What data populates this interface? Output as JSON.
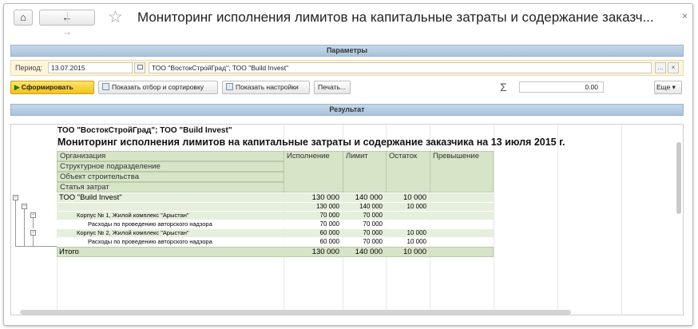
{
  "window": {
    "title": "Мониторинг исполнения лимитов на капитальные затраты и содержание заказч...",
    "close_glyph": "×",
    "home_glyph": "⌂",
    "back_glyph": "←",
    "forward_glyph": "→",
    "star_glyph": "☆"
  },
  "params": {
    "section_label": "Параметры",
    "period_label": "Период:",
    "period_value": "13.07.2015",
    "org_value": "ТОО \"ВостокСтройГрад\"; ТОО \"Build Invest\"",
    "select_glyph": "...",
    "clear_glyph": "×"
  },
  "toolbar": {
    "generate_label": "Сформировать",
    "filter_label": "Показать отбор и сортировку",
    "settings_label": "Показать настройки",
    "print_label": "Печать...",
    "sum_glyph": "Σ",
    "sum_value": "0.00",
    "more_label": "Еще ▾"
  },
  "result": {
    "section_label": "Результат",
    "orgs_line": "ТОО \"ВостокСтройГрад\"; ТОО \"Build Invest\"",
    "report_title": "Мониторинг исполнения лимитов на капитальные затраты и содержание заказчика на 13 июля 2015 г.",
    "header": {
      "organization": "Организация",
      "department": "Структурное подразделение",
      "object": "Объект строительства",
      "article": "Статья затрат",
      "execution": "Исполнение",
      "limit": "Лимит",
      "remainder": "Остаток",
      "excess": "Превышение"
    },
    "rows": [
      {
        "name": "ТОО \"Build Invest\"",
        "execution": "130 000",
        "limit": "140 000",
        "remainder": "10 000"
      },
      {
        "name": "",
        "execution": "130 000",
        "limit": "140 000",
        "remainder": "10 000"
      },
      {
        "name": "Корпус № 1, Жилой комплекс \"Арыстан\"",
        "execution": "70 000",
        "limit": "70 000",
        "remainder": ""
      },
      {
        "name": "Расходы по проведению авторского надзора",
        "execution": "70 000",
        "limit": "70 000",
        "remainder": ""
      },
      {
        "name": "Корпус № 2, Жилой комплекс \"Арыстан\"",
        "execution": "60 000",
        "limit": "70 000",
        "remainder": "10 000"
      },
      {
        "name": "Расходы по проведению авторского надзора",
        "execution": "60 000",
        "limit": "70 000",
        "remainder": "10 000"
      }
    ],
    "total": {
      "name": "Итого",
      "execution": "130 000",
      "limit": "140 000",
      "remainder": "10 000"
    },
    "tree_glyph": "−"
  }
}
